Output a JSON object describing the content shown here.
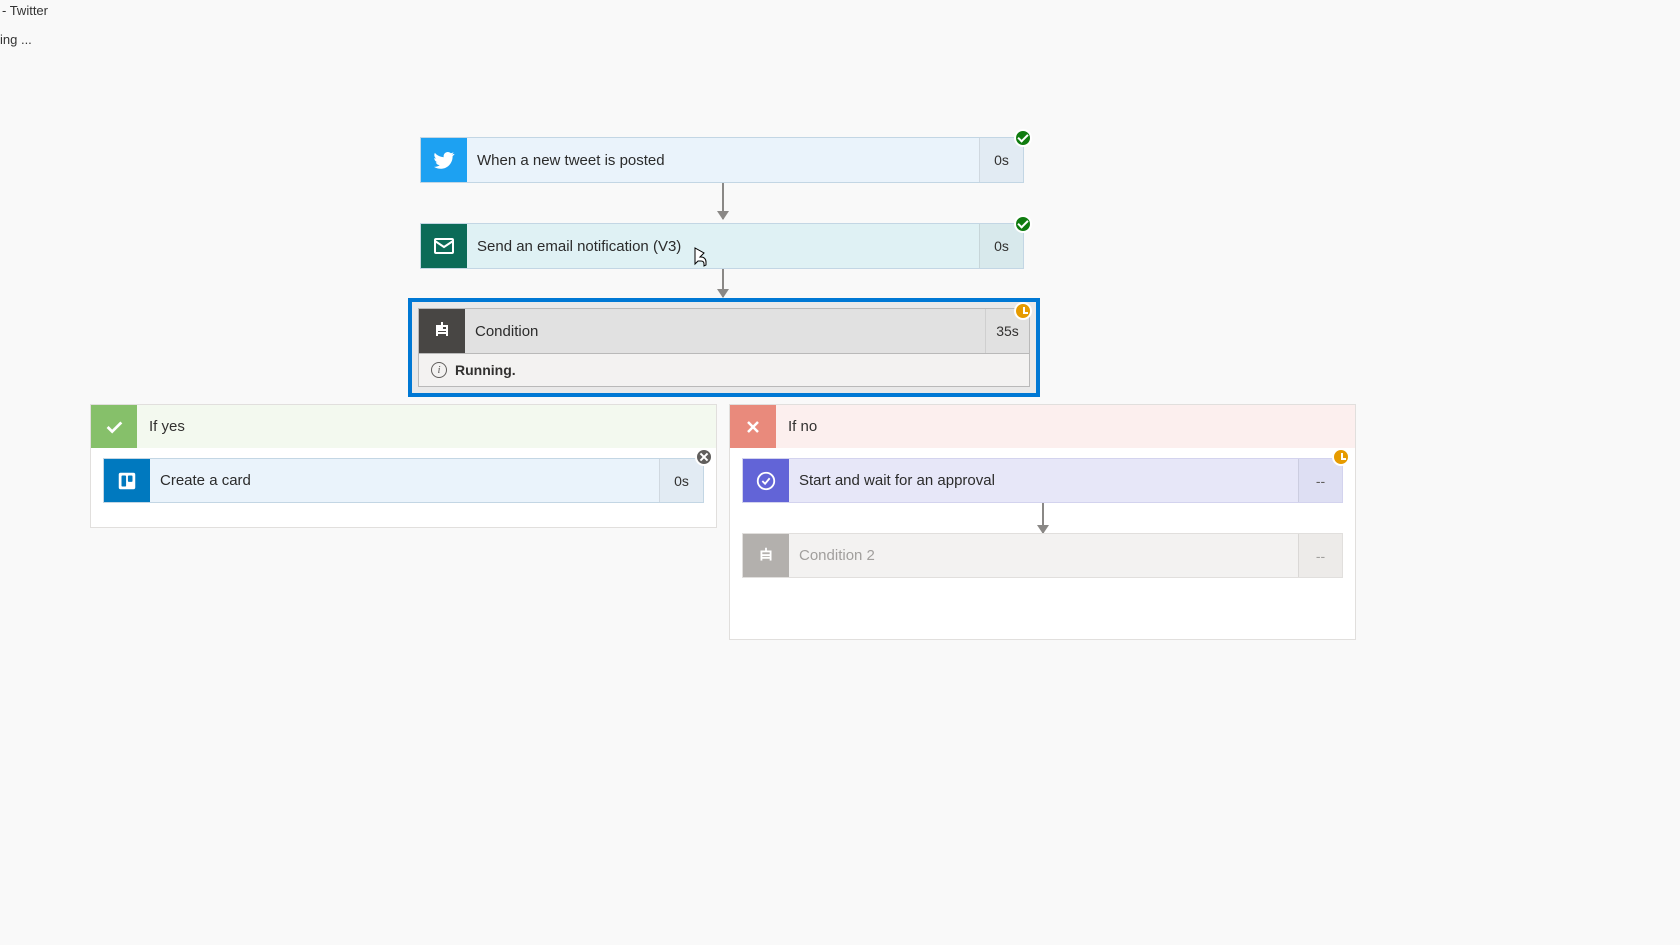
{
  "browser": {
    "title_suffix": "- Twitter",
    "status": "ing ..."
  },
  "flow": {
    "steps": {
      "trigger": {
        "label": "When a new tweet is posted",
        "duration": "0s",
        "status": "succeeded"
      },
      "email": {
        "label": "Send an email notification (V3)",
        "duration": "0s",
        "status": "succeeded"
      },
      "condition": {
        "label": "Condition",
        "duration": "35s",
        "status": "running",
        "status_text": "Running."
      }
    },
    "branches": {
      "yes": {
        "title": "If yes",
        "steps": {
          "create_card": {
            "label": "Create a card",
            "duration": "0s",
            "status": "cancelled"
          }
        }
      },
      "no": {
        "title": "If no",
        "steps": {
          "approval": {
            "label": "Start and wait for an approval",
            "duration": "--",
            "status": "running"
          },
          "condition2": {
            "label": "Condition 2",
            "duration": "--",
            "status": "pending"
          }
        }
      }
    }
  }
}
